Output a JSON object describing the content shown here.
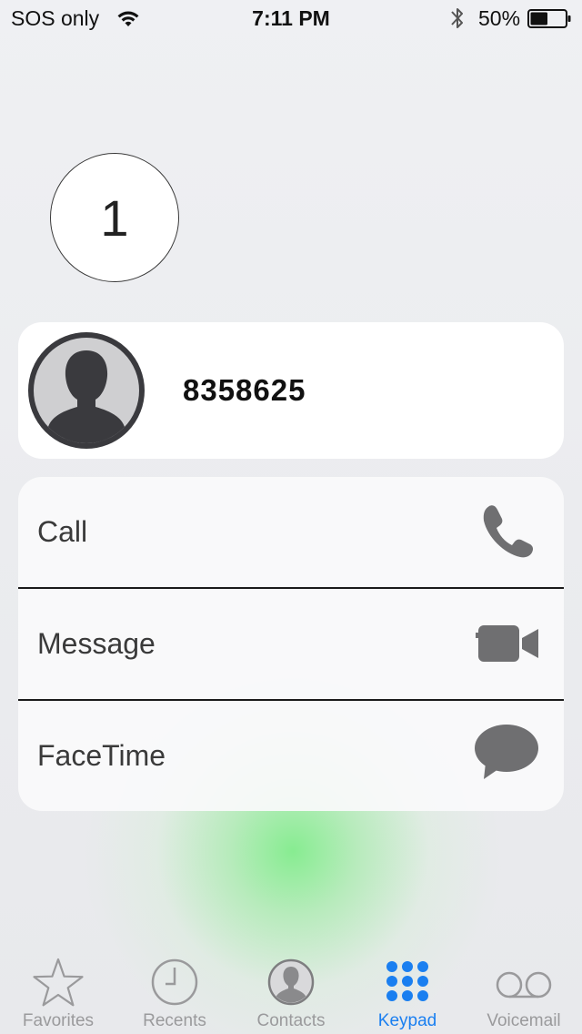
{
  "status_bar": {
    "carrier": "SOS only",
    "time": "7:11 PM",
    "battery_percent": "50%",
    "battery_level": 0.5
  },
  "badge": {
    "value": "1"
  },
  "contact": {
    "number": "8358625",
    "avatar_icon": "person-silhouette-icon"
  },
  "actions": [
    {
      "label": "Call",
      "icon": "phone-icon"
    },
    {
      "label": "Message",
      "icon": "video-camera-icon"
    },
    {
      "label": "FaceTime",
      "icon": "speech-bubble-icon"
    }
  ],
  "tabs": [
    {
      "label": "Favorites",
      "icon": "star-icon",
      "active": false
    },
    {
      "label": "Recents",
      "icon": "clock-icon",
      "active": false
    },
    {
      "label": "Contacts",
      "icon": "contact-person-icon",
      "active": false
    },
    {
      "label": "Keypad",
      "icon": "keypad-dots-icon",
      "active": true
    },
    {
      "label": "Voicemail",
      "icon": "voicemail-icon",
      "active": false
    }
  ],
  "colors": {
    "accent": "#1a7ff0",
    "tab_inactive": "#9a9a9c",
    "icon_gray": "#6f6f71",
    "avatar_dark": "#3a3a3e",
    "avatar_light": "#cfcfd1"
  }
}
